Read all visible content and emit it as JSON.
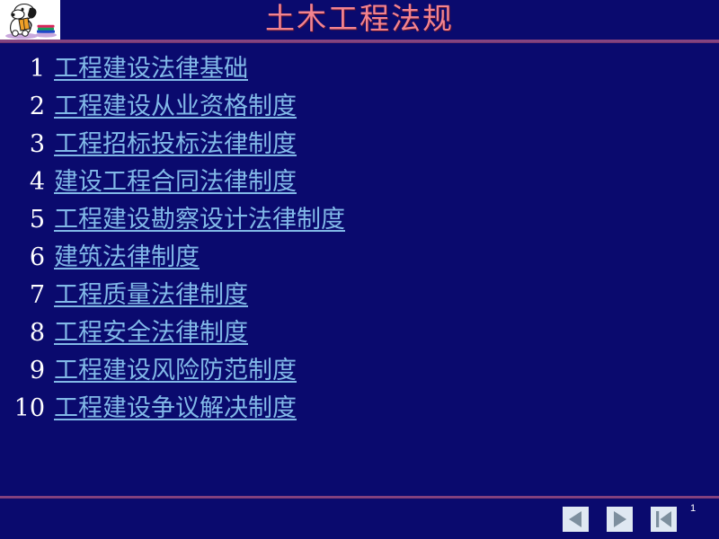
{
  "slide": {
    "title": "土木工程法规",
    "background_color": "#0a0a6e",
    "title_color": "#f2838f",
    "rule_color": "#8c4a88",
    "link_color": "#82b9e8",
    "number_color": "#ffffff",
    "page_number": "1"
  },
  "logo": {
    "icon": "dog-reading-book-icon",
    "alt": "卡通小狗读书图标"
  },
  "toc": {
    "items": [
      {
        "number": "1",
        "label": "工程建设法律基础"
      },
      {
        "number": "2",
        "label": "工程建设从业资格制度"
      },
      {
        "number": "3",
        "label": "工程招标投标法律制度"
      },
      {
        "number": "4",
        "label": "建设工程合同法律制度"
      },
      {
        "number": "5",
        "label": "工程建设勘察设计法律制度"
      },
      {
        "number": "6",
        "label": "建筑法律制度"
      },
      {
        "number": "7",
        "label": "工程质量法律制度"
      },
      {
        "number": "8",
        "label": "工程安全法律制度"
      },
      {
        "number": "9",
        "label": "工程建设风险防范制度"
      },
      {
        "number": "10",
        "label": "工程建设争议解决制度"
      }
    ]
  },
  "navigation": {
    "previous": {
      "icon": "triangle-left-icon",
      "label": "上一页"
    },
    "next": {
      "icon": "triangle-right-icon",
      "label": "下一页"
    },
    "first": {
      "icon": "triangle-left-bar-icon",
      "label": "第一页"
    }
  }
}
